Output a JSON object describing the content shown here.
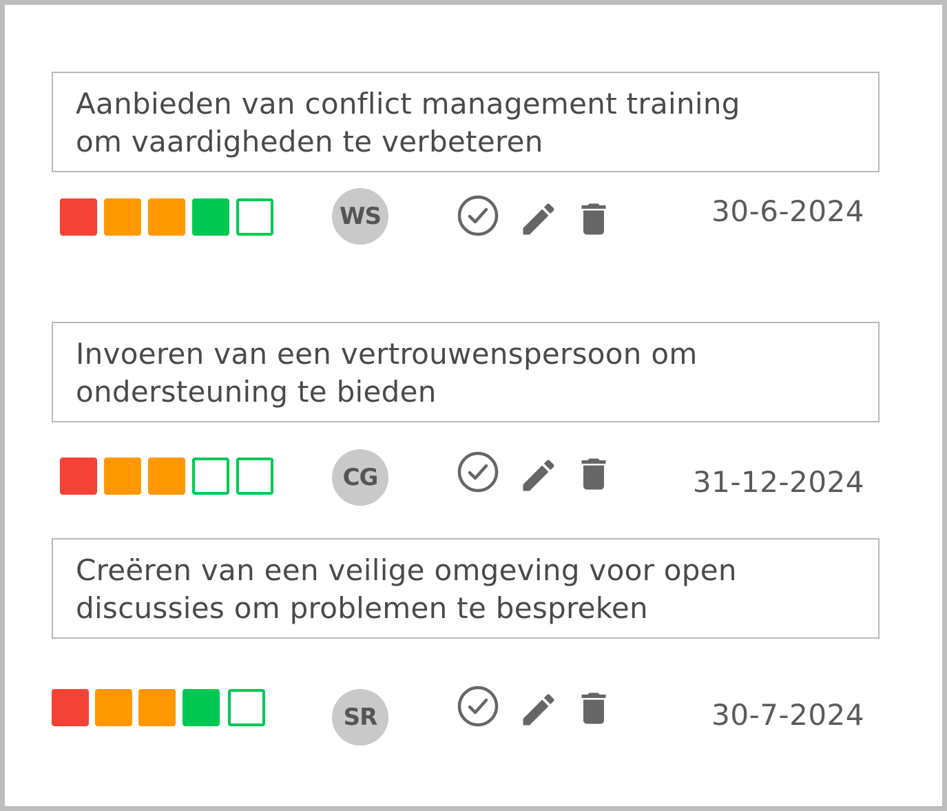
{
  "actions": [
    {
      "description": "Aanbieden van conflict management training\nom vaardigheden te verbeteren",
      "scale": [
        "#f44336",
        "#ff9800",
        "#ff9800",
        "#00c853",
        "empty"
      ],
      "avatar_initials": "WS",
      "date": "30-6-2024"
    },
    {
      "description": "Invoeren van een vertrouwenspersoon om\nondersteuning te bieden",
      "scale": [
        "#f44336",
        "#ff9800",
        "#ff9800",
        "empty",
        "empty"
      ],
      "avatar_initials": "CG",
      "date": "31-12-2024"
    },
    {
      "description": "Creëren van een veilige omgeving voor open\ndiscussies om problemen te bespreken",
      "scale": [
        "#f44336",
        "#ff9800",
        "#ff9800",
        "#00c853",
        "empty"
      ],
      "avatar_initials": "SR",
      "date": "30-7-2024"
    }
  ],
  "icons": {
    "complete": "check-circle-icon",
    "edit": "pencil-icon",
    "delete": "trash-icon"
  },
  "colors": {
    "red": "#f44336",
    "orange": "#ff9800",
    "green": "#00c853",
    "icon": "#666666",
    "border": "#b8b8b8"
  }
}
